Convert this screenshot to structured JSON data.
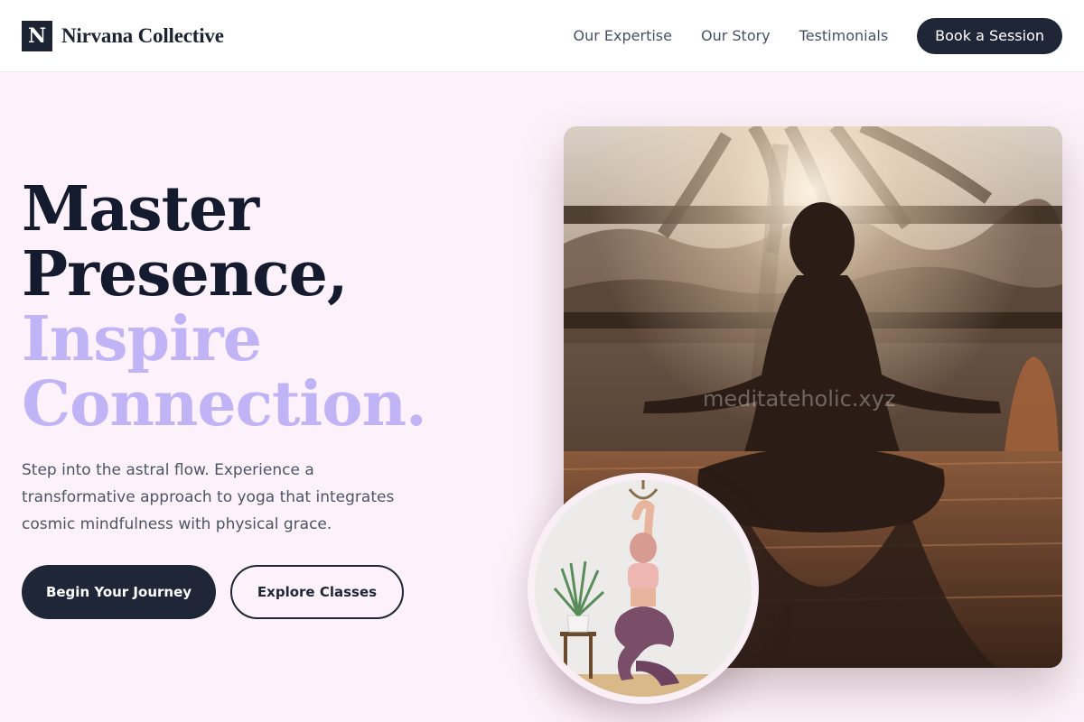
{
  "header": {
    "logo_letter": "N",
    "brand_name": "Nirvana Collective",
    "nav": [
      "Our Expertise",
      "Our Story",
      "Testimonials"
    ],
    "cta_label": "Book a Session"
  },
  "hero": {
    "title_line1": "Master",
    "title_line2": "Presence,",
    "title_line3": "Inspire",
    "title_line4": "Connection.",
    "subtitle": "Step into the astral flow. Experience a transformative approach to yoga that integrates cosmic mindfulness with physical grace.",
    "primary_button": "Begin Your Journey",
    "secondary_button": "Explore Classes"
  },
  "media": {
    "main_image_watermark": "meditateholic.xyz"
  },
  "colors": {
    "background": "#fdf2fb",
    "dark": "#1e2638",
    "accent": "#c1b4f6"
  }
}
